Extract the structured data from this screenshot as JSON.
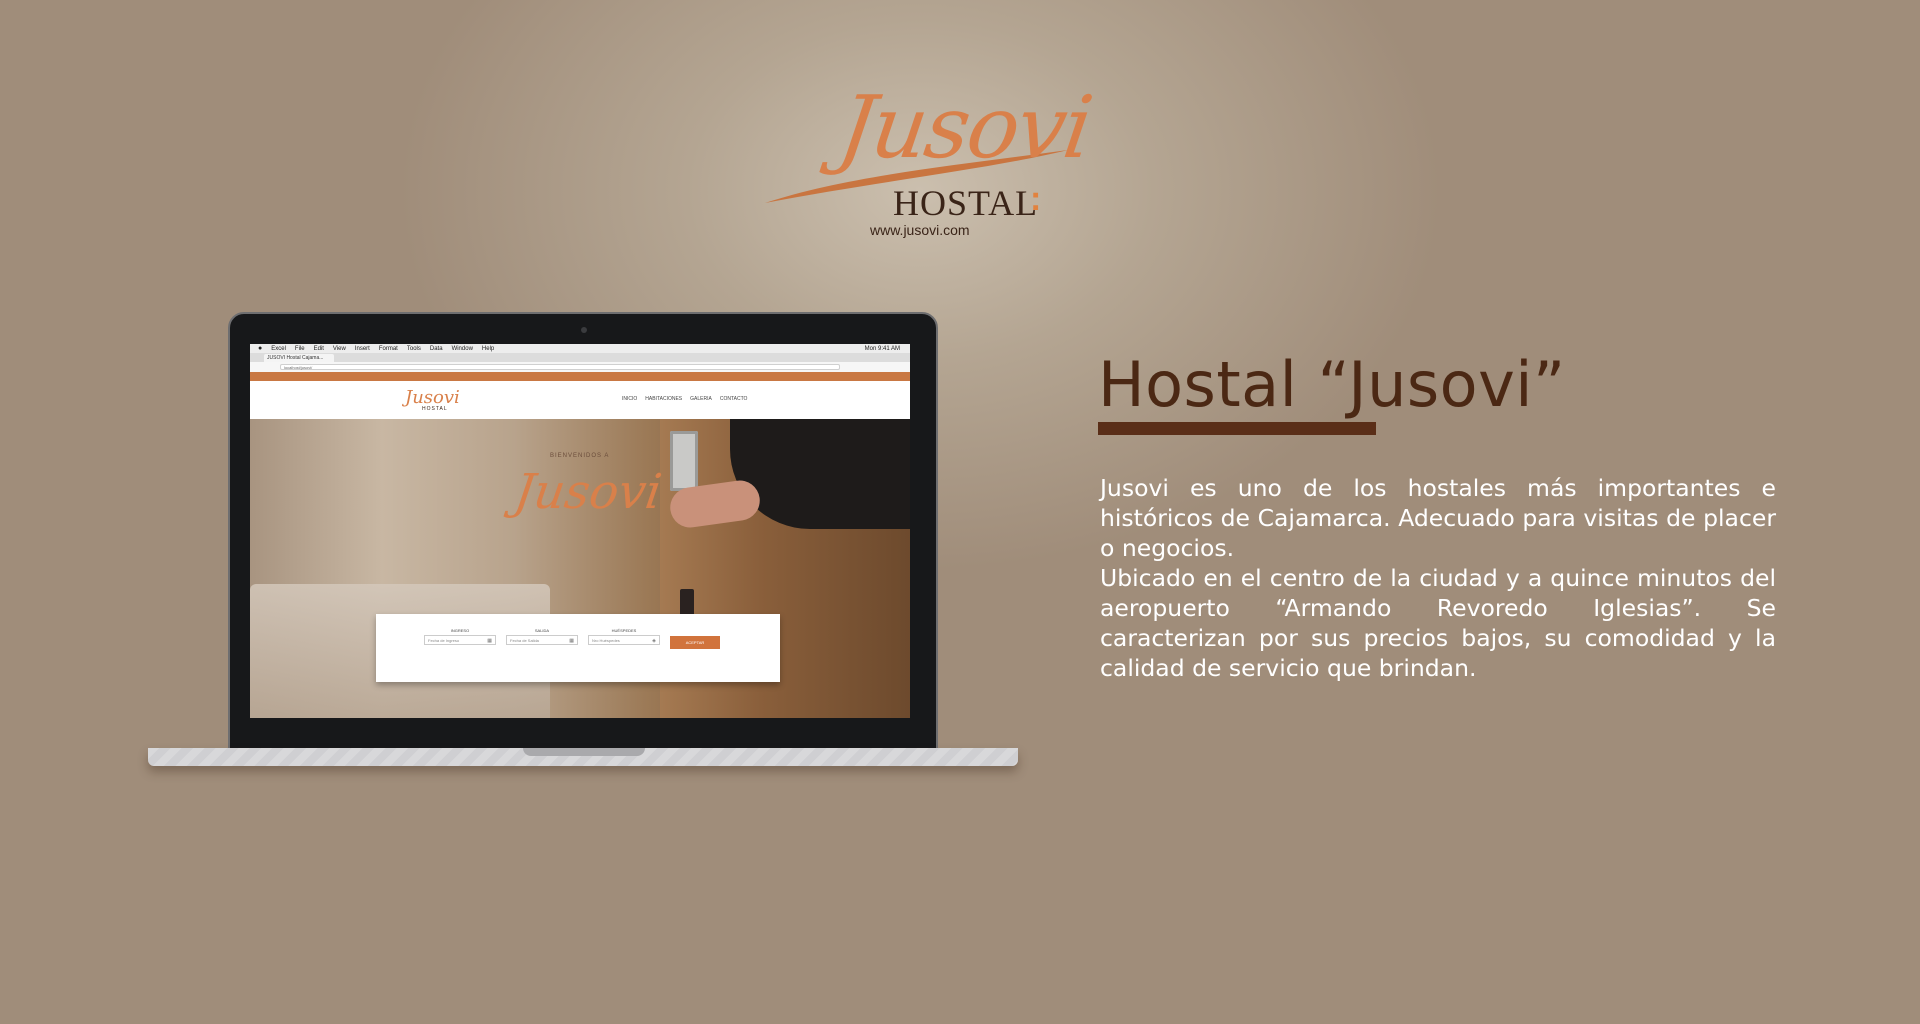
{
  "logo": {
    "script_text": "Jusovi",
    "hostal_text": "HOSTAL",
    "colon": ":",
    "url": "www.jusovi.com",
    "brand_color": "#d9804a",
    "dark_color": "#3a2418"
  },
  "laptop": {
    "mac_menu": [
      "Excel",
      "File",
      "Edit",
      "View",
      "Insert",
      "Format",
      "Tools",
      "Data",
      "Window",
      "Help"
    ],
    "mac_clock": "Mon 9:41 AM",
    "browser_tab": "JUSOVI Hostal Cajama...",
    "url": "localhost/jusovi/",
    "site": {
      "topbar_color": "#c97843",
      "logo_script": "Jusovi",
      "logo_sub": "HOSTAL",
      "nav": [
        "INICIO",
        "HABITACIONES",
        "GALERIA",
        "CONTACTO"
      ],
      "welcome": "BIENVENIDOS A",
      "hero_script": "Jusovi",
      "booking": {
        "checkin_label": "INGRESO",
        "checkin_placeholder": "Fecha de Ingreso",
        "checkout_label": "SALIDA",
        "checkout_placeholder": "Fecha de Salida",
        "guests_label": "HUÉSPEDES",
        "guests_placeholder": "Nro Huéspedes",
        "submit_label": "ACEPTAR",
        "button_color": "#d1733c"
      }
    }
  },
  "content": {
    "title": "Hostal “Jusovi”",
    "title_color": "#4b2814",
    "paragraph_1": "Jusovi es uno de los hostales más importantes e históricos de Cajamarca. Adecuado para visitas de placer o negocios.",
    "paragraph_2": "Ubicado en el centro de la ciudad y a quince minutos del aeropuerto “Armando Revoredo Iglesias”. Se caracterizan por sus precios bajos, su comodidad y la calidad de servicio que brindan."
  }
}
